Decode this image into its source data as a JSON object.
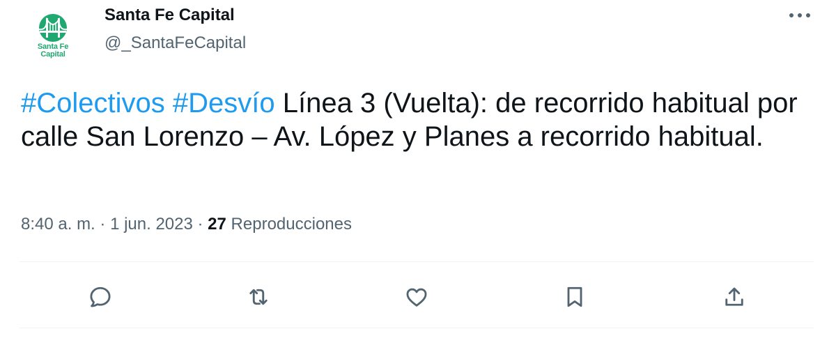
{
  "tweet": {
    "author": {
      "display_name": "Santa Fe Capital",
      "handle": "@_SantaFeCapital",
      "avatar": {
        "logo_line1": "Santa Fe",
        "logo_line2": "Capital",
        "brand_color": "#1fa870",
        "icon": "bridge-icon"
      }
    },
    "body": {
      "hashtag1": "#Colectivos",
      "hashtag2": "#Desvío",
      "text": "Línea 3 (Vuelta): de recorrido habitual por calle San Lorenzo – Av. López y Planes a recorrido habitual."
    },
    "meta": {
      "time": "8:40 a. m.",
      "sep1": " · ",
      "date": "1 jun. 2023",
      "sep2": " · ",
      "views_count": "27",
      "views_label": "Reproducciones"
    },
    "actions": [
      {
        "name": "reply",
        "icon": "reply-icon"
      },
      {
        "name": "retweet",
        "icon": "retweet-icon"
      },
      {
        "name": "like",
        "icon": "heart-icon"
      },
      {
        "name": "bookmark",
        "icon": "bookmark-icon"
      },
      {
        "name": "share",
        "icon": "share-icon"
      }
    ],
    "more_icon": "more-icon",
    "colors": {
      "hashtag": "#1d9bf0",
      "text": "#0f1419",
      "secondary": "#536471",
      "divider": "#eff3f4"
    }
  }
}
